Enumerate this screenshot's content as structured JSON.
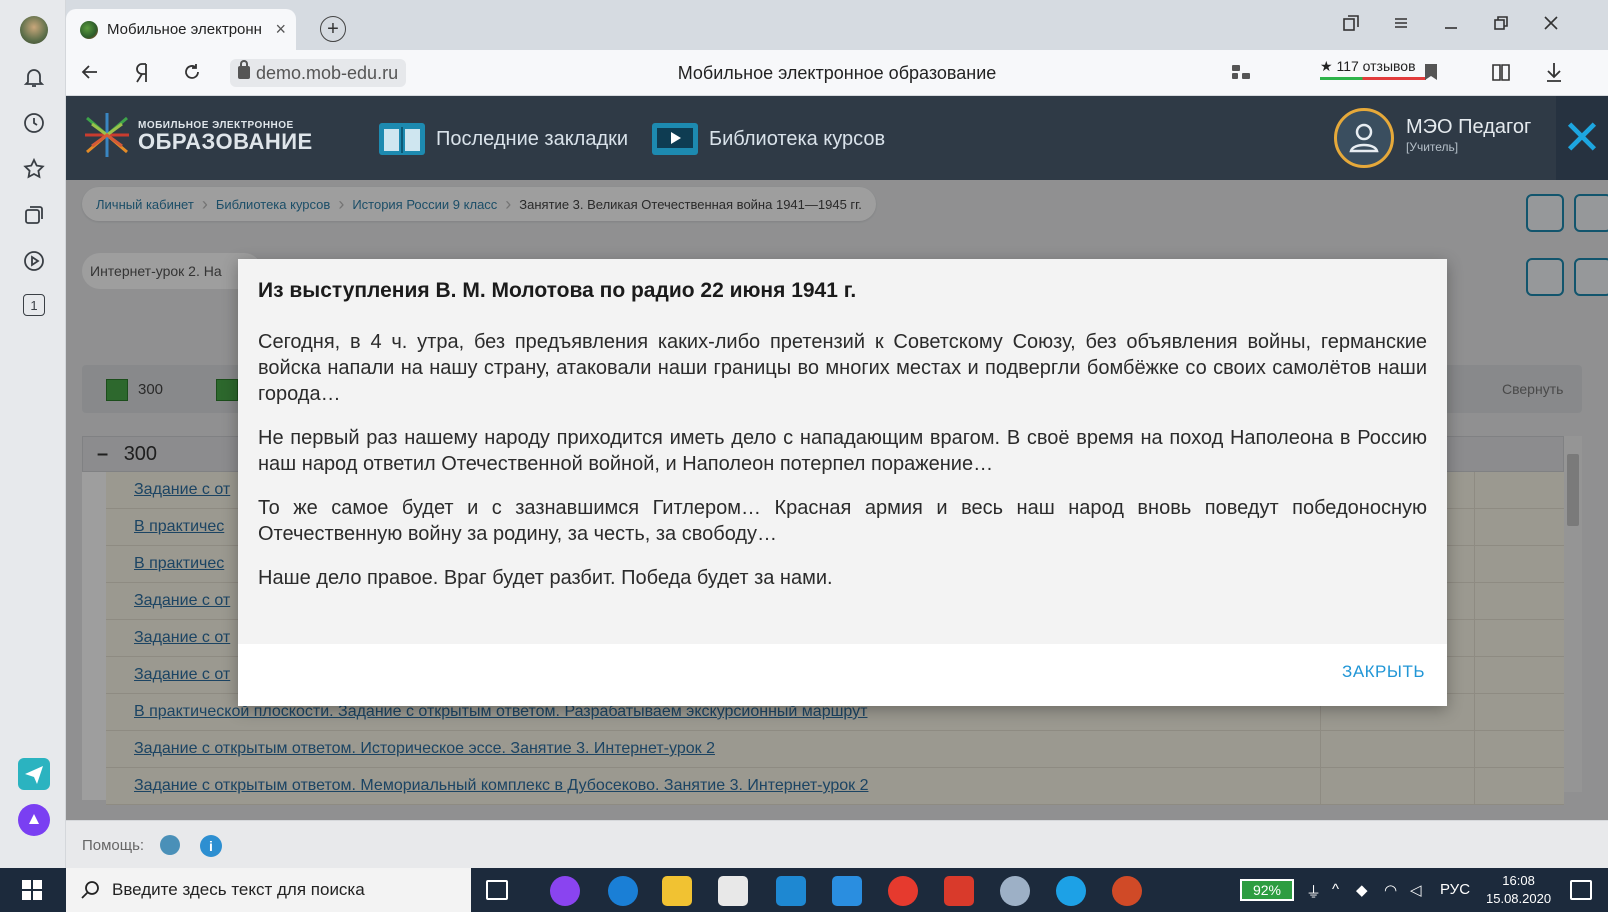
{
  "browser": {
    "tab_title": "Мобильное электронн",
    "tab_close": "×",
    "new_tab": "+",
    "url": "demo.mob-edu.ru",
    "page_title": "Мобильное электронное образование",
    "reviews": "★ 117 отзывов",
    "sidebar_counter": "1"
  },
  "app": {
    "logo_small": "МОБИЛЬНОЕ ЭЛЕКТРОННОЕ",
    "logo_big": "ОБРАЗОВАНИЕ",
    "nav_bookmarks": "Последние закладки",
    "nav_library": "Библиотека курсов",
    "user_name": "МЭО Педагог",
    "user_role": "[Учитель]",
    "close_x": "✕"
  },
  "breadcrumbs": [
    "Личный кабинет",
    "Библиотека курсов",
    "История России 9 класс",
    "Занятие 3. Великая Отечественная война 1941—1945 гг."
  ],
  "lesson_pill": "Интернет-урок 2. На",
  "filter": {
    "chip_value": "300",
    "collapse_label": "Свернуть"
  },
  "list": {
    "group_label": "300",
    "rows": [
      "Задание с от",
      "В практичес",
      "В практичес",
      "Задание с от",
      "Задание с от",
      "Задание с от",
      "В практической плоскости. Задание с открытым ответом. Разрабатываем экскурсионный маршрут",
      "Задание с открытым ответом. Историческое эссе. Занятие 3. Интернет-урок 2",
      "Задание с открытым ответом. Мемориальный комплекс в Дубосеково. Занятие 3. Интернет-урок 2"
    ]
  },
  "help": {
    "label": "Помощь:"
  },
  "modal": {
    "title": "Из выступления В. М. Молотова по радио 22 июня 1941 г.",
    "paragraphs": [
      "Сегодня, в 4 ч. утра, без предъявления каких-либо претензий к Советскому Союзу, без объявления войны, германские войска напали на нашу страну, атаковали наши границы во многих местах и подвергли бомбёжке со своих самолётов наши города…",
      "Не первый раз нашему народу приходится иметь дело с нападающим врагом. В своё время на поход Наполеона в Россию наш народ ответил Отечественной войной, и Наполеон потерпел поражение…",
      "То же самое будет и с зазнавшимся Гитлером… Красная армия и весь наш народ вновь поведут победоносную Отечественную войну за родину, за честь, за свободу…",
      "Наше дело правое. Враг будет разбит. Победа будет за нами."
    ],
    "close_button": "ЗАКРЫТЬ"
  },
  "taskbar": {
    "search_placeholder": "Введите здесь текст для поиска",
    "battery": "92%",
    "language": "РУС",
    "time": "16:08",
    "date": "15.08.2020"
  }
}
